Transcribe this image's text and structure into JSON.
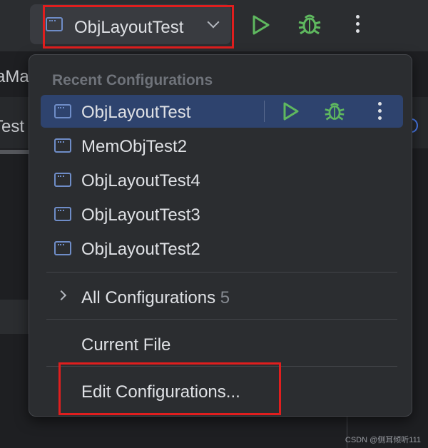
{
  "toolbar": {
    "run_config": {
      "label": "ObjLayoutTest",
      "icon": "run-config-icon"
    },
    "run_icon": "play-icon",
    "debug_icon": "bug-icon",
    "more_icon": "more-vertical-icon"
  },
  "background": {
    "tab_fragment_1": "aMa",
    "tab_fragment_2": "Test"
  },
  "popup": {
    "header": "Recent Configurations",
    "items": [
      {
        "label": "ObjLayoutTest",
        "selected": true
      },
      {
        "label": "MemObjTest2"
      },
      {
        "label": "ObjLayoutTest4"
      },
      {
        "label": "ObjLayoutTest3"
      },
      {
        "label": "ObjLayoutTest2"
      }
    ],
    "all_configurations": {
      "label": "All Configurations",
      "count": "5"
    },
    "current_file": "Current File",
    "edit_configurations": "Edit Configurations..."
  },
  "watermark": "CSDN @侧耳倾听111",
  "colors": {
    "highlight": "#e01e1e",
    "run_green": "#5fb85f",
    "selected_row": "#2e436e",
    "popup_bg": "#2b2d30"
  }
}
